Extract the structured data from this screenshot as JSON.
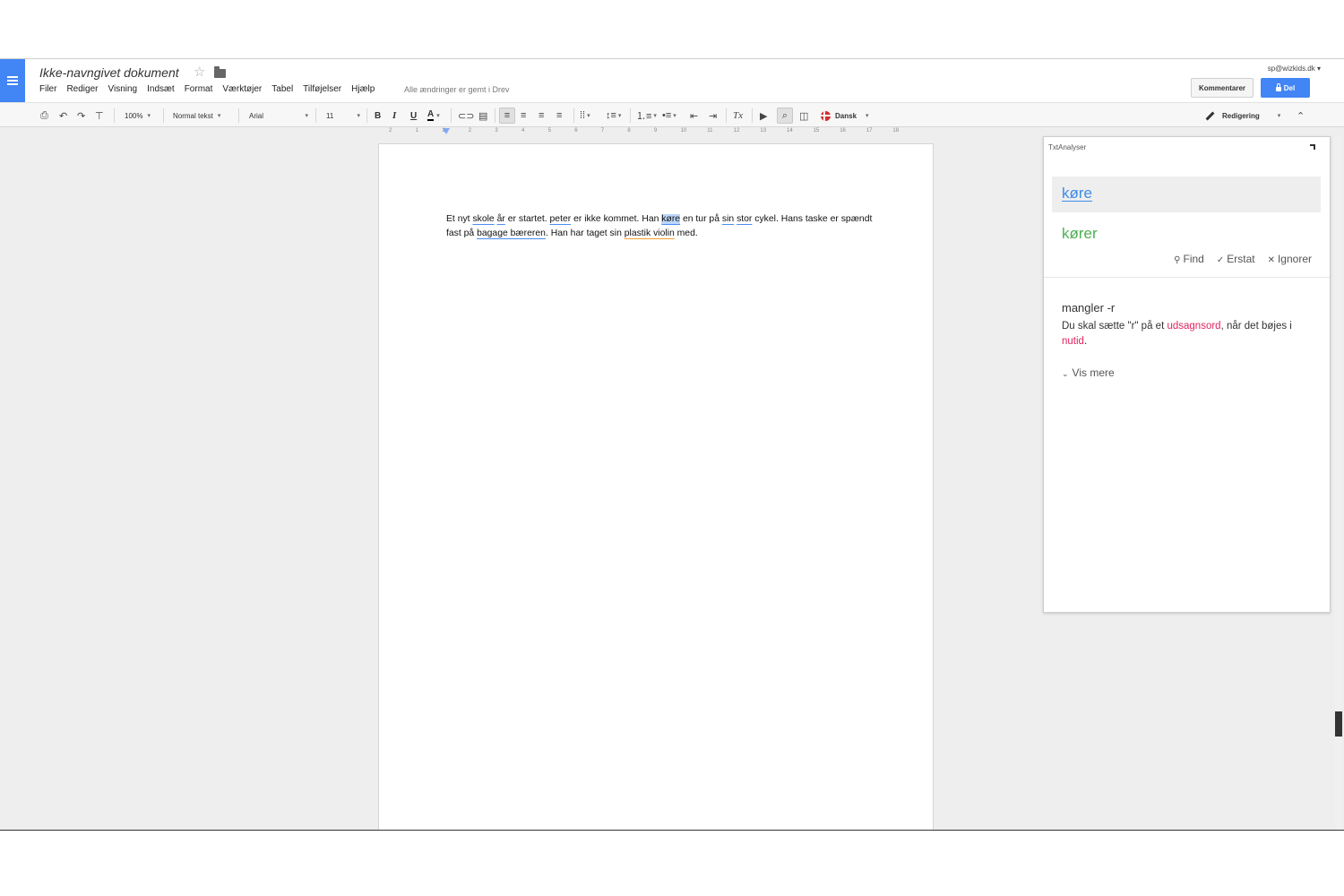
{
  "header": {
    "doc_title": "Ikke-navngivet dokument",
    "save_status": "Alle ændringer er gemt i Drev",
    "user_email": "sp@wizkids.dk",
    "comments_label": "Kommentarer",
    "share_label": "Del"
  },
  "menu": [
    "Filer",
    "Rediger",
    "Visning",
    "Indsæt",
    "Format",
    "Værktøjer",
    "Tabel",
    "Tilføjelser",
    "Hjælp"
  ],
  "toolbar": {
    "zoom": "100%",
    "style": "Normal tekst",
    "font": "Arial",
    "font_size": "11",
    "bold": "B",
    "italic": "I",
    "underline": "U",
    "text_color": "A",
    "language": "Dansk",
    "mode": "Redigering"
  },
  "ruler": [
    "2",
    "1",
    "1",
    "2",
    "3",
    "4",
    "5",
    "6",
    "7",
    "8",
    "9",
    "10",
    "11",
    "12",
    "13",
    "14",
    "15",
    "16",
    "17",
    "18"
  ],
  "document": {
    "t1": "Et nyt ",
    "w_skole": "skole",
    "t2": " ",
    "w_ar": "år",
    "t3": " er startet. ",
    "w_peter": "peter",
    "t4": " er ikke kommet. Han ",
    "w_kore": "køre",
    "t5": " en tur på ",
    "w_sin": "sin",
    "t6": " ",
    "w_stor": "stor",
    "t7": " cykel. Hans taske er spændt fast på ",
    "w_bagage": "bagage bæreren",
    "t8": ". Han har taget sin ",
    "w_plastik": "plastik violin",
    "t9": " med."
  },
  "panel": {
    "title": "TxtAnalyser",
    "error_word": "køre",
    "suggestion": "kører",
    "find_label": "Find",
    "replace_label": "Erstat",
    "ignore_label": "Ignorer",
    "rule_title": "mangler -r",
    "rule_desc_1": "Du skal sætte \"r\" på et ",
    "rule_desc_link1": "udsagnsord",
    "rule_desc_2": ", når det bøjes i ",
    "rule_desc_link2": "nutid",
    "rule_desc_3": ".",
    "more_label": "Vis mere"
  },
  "colors": {
    "accent": "#4285f4",
    "error_underline": "#4a8cf0",
    "warning_underline": "#f0a030",
    "suggestion": "#4caf50",
    "grammar_term": "#e0245e"
  }
}
